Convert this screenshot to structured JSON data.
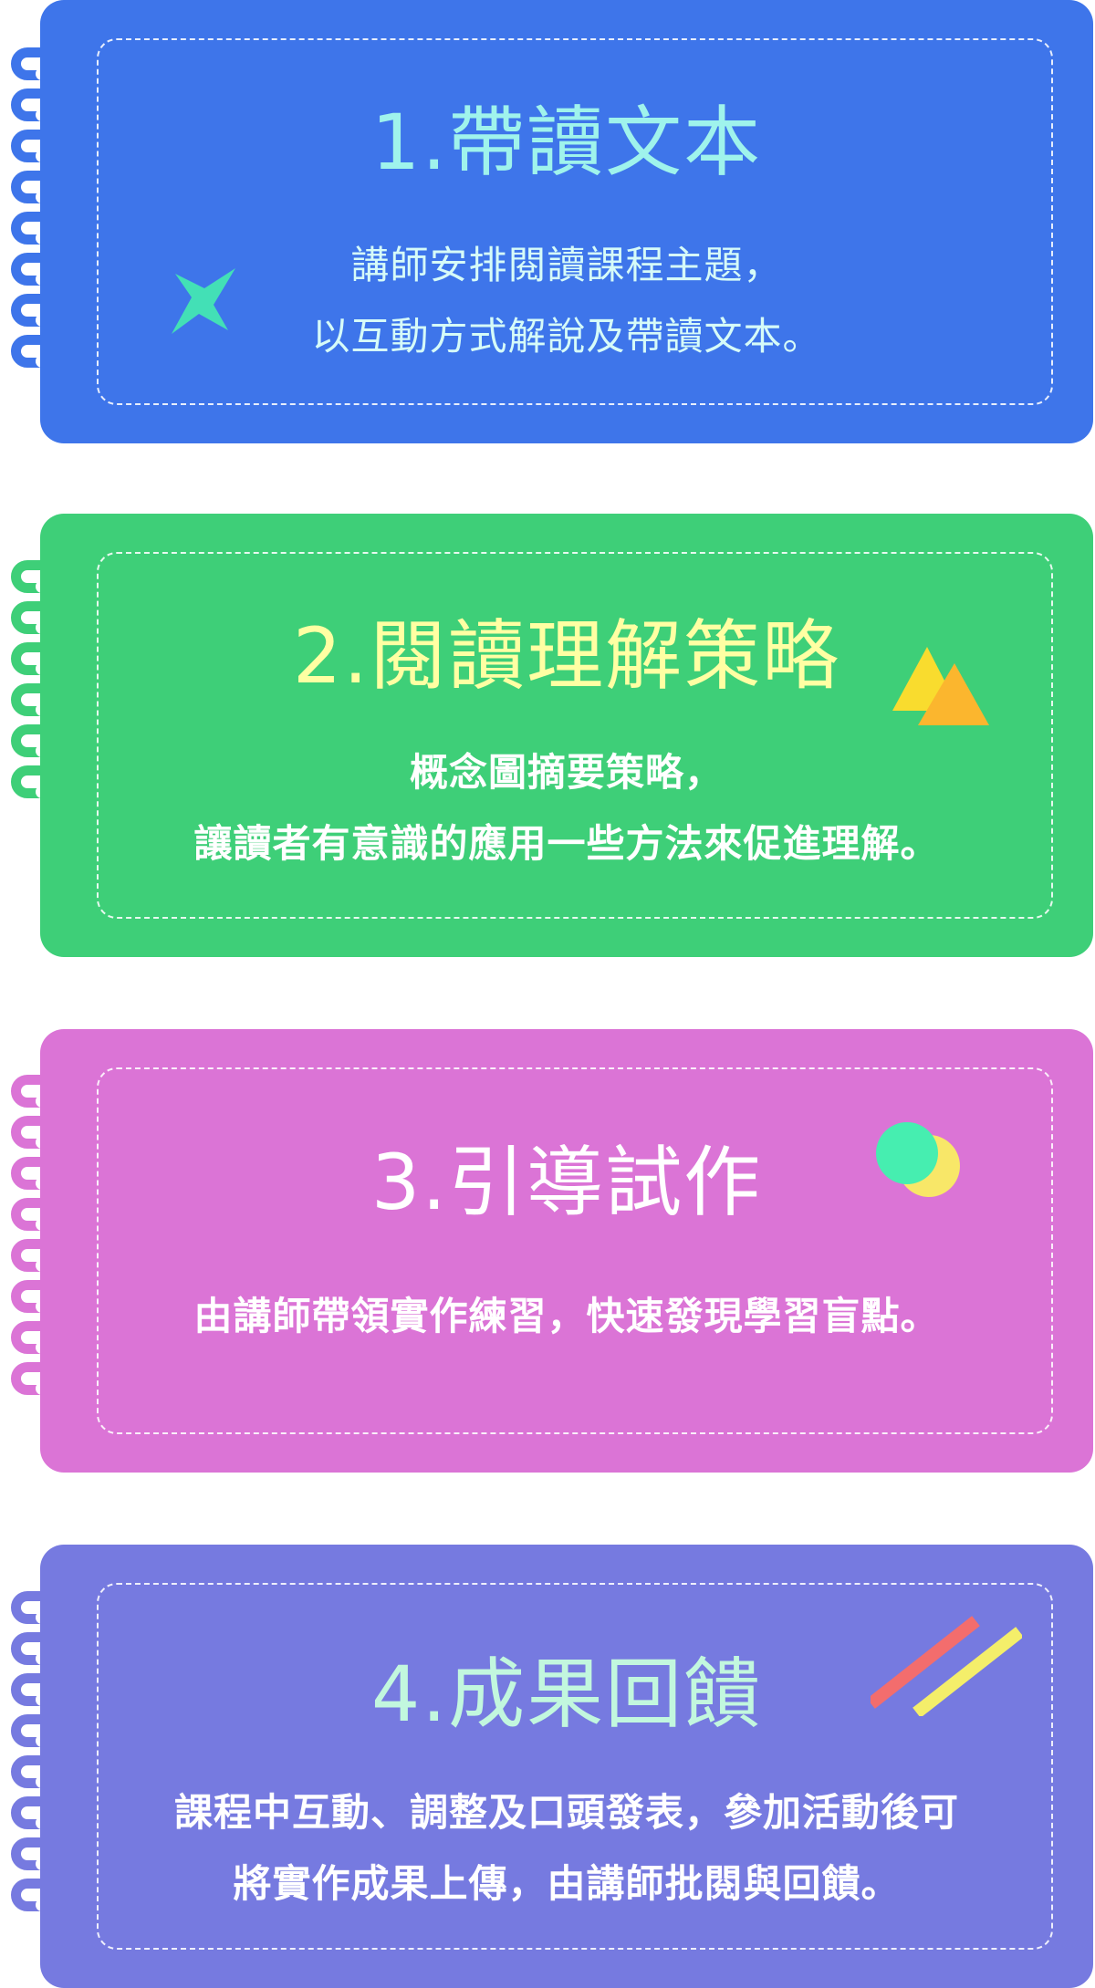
{
  "cards": [
    {
      "title": "1.帶讀文本",
      "lines": [
        "講師安排閱讀課程主題，",
        "以互動方式解說及帶讀文本。"
      ],
      "color": "#3e75ea",
      "decoration": "star-icon"
    },
    {
      "title": "2.閱讀理解策略",
      "lines": [
        "概念圖摘要策略，",
        "讓讀者有意識的應用一些方法來促進理解。"
      ],
      "color": "#3ecf78",
      "decoration": "triangles-icon"
    },
    {
      "title": "3.引導試作",
      "lines": [
        "由講師帶領實作練習，快速發現學習盲點。"
      ],
      "color": "#db74d6",
      "decoration": "circles-icon"
    },
    {
      "title": "4.成果回饋",
      "lines": [
        "課程中互動、調整及口頭發表，參加活動後可",
        "將實作成果上傳，由講師批閱與回饋。"
      ],
      "color": "#767ae0",
      "decoration": "stripes-icon"
    }
  ]
}
